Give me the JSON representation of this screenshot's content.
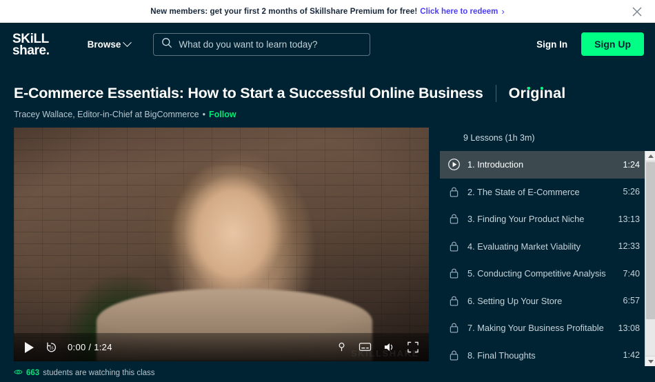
{
  "promo": {
    "text": "New members: get your first 2 months of Skillshare Premium for free!",
    "link_label": "Click here to redeem",
    "chevron": "›",
    "close_icon": "close-icon"
  },
  "header": {
    "logo_line1": "SKiLL",
    "logo_line2": "share.",
    "browse_label": "Browse",
    "search_placeholder": "What do you want to learn today?",
    "search_value": "",
    "sign_in_label": "Sign In",
    "sign_up_label": "Sign Up",
    "accent_green": "#00ff84",
    "background": "#002333"
  },
  "class": {
    "title": "E-Commerce Essentials: How to Start a Successful Online Business",
    "badge": "Original",
    "author": "Tracey Wallace, Editor-in-Chief at BigCommerce",
    "separator_dot": "•",
    "follow_label": "Follow"
  },
  "player": {
    "current_time": "0:00",
    "time_separator": "/",
    "duration": "1:24",
    "time_display": "0:00 / 1:24",
    "watermark": "SKILLSHARE",
    "controls": {
      "play": "play-icon",
      "rewind": "rewind-15-icon",
      "pin": "pin-icon",
      "captions": "captions-icon",
      "volume": "volume-icon",
      "fullscreen": "fullscreen-icon"
    }
  },
  "lessons_panel": {
    "summary": "9 Lessons (1h 3m)",
    "active_index": 0,
    "items": [
      {
        "label": "1. Introduction",
        "duration": "1:24",
        "icon": "play-circle-icon",
        "locked": false
      },
      {
        "label": "2. The State of E-Commerce",
        "duration": "5:26",
        "icon": "lock-icon",
        "locked": true
      },
      {
        "label": "3. Finding Your Product Niche",
        "duration": "13:13",
        "icon": "lock-icon",
        "locked": true
      },
      {
        "label": "4. Evaluating Market Viability",
        "duration": "12:33",
        "icon": "lock-icon",
        "locked": true
      },
      {
        "label": "5. Conducting Competitive Analysis",
        "duration": "7:40",
        "icon": "lock-icon",
        "locked": true
      },
      {
        "label": "6. Setting Up Your Store",
        "duration": "6:57",
        "icon": "lock-icon",
        "locked": true
      },
      {
        "label": "7. Making Your Business Profitable",
        "duration": "13:08",
        "icon": "lock-icon",
        "locked": true
      },
      {
        "label": "8. Final Thoughts",
        "duration": "1:42",
        "icon": "lock-icon",
        "locked": true
      }
    ]
  },
  "status": {
    "eye_icon": "eye-icon",
    "count": "663",
    "text": "students are watching this class",
    "count_color": "#00e676"
  }
}
